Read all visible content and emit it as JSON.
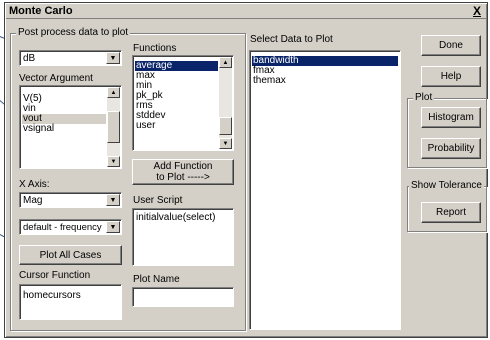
{
  "window": {
    "title": "Monte Carlo",
    "close_label": "X"
  },
  "post_process": {
    "group_label": "Post process data to plot",
    "units_combo": "dB",
    "vector_label": "Vector Argument",
    "vector_items": [
      "V(5)",
      "vin",
      "vout",
      "vsignal"
    ],
    "vector_selected": "vout",
    "xaxis_label": "X Axis:",
    "xaxis_combo": "Mag",
    "freq_combo": "default - frequency",
    "plot_all_button": "Plot All Cases",
    "cursor_label": "Cursor Function",
    "cursor_value": "homecursors"
  },
  "functions": {
    "label": "Functions",
    "items": [
      "average",
      "max",
      "min",
      "pk_pk",
      "rms",
      "stddev",
      "user"
    ],
    "selected": "average",
    "add_button": "Add Function\nto Plot   ----->",
    "script_label": "User Script",
    "script_value": "initialvalue(select)",
    "plot_name_label": "Plot Name",
    "plot_name_value": ""
  },
  "select_data": {
    "label": "Select Data to Plot",
    "items": [
      "bandwidth",
      "fmax",
      "themax"
    ],
    "selected": "bandwidth"
  },
  "buttons": {
    "done": "Done",
    "help": "Help",
    "plot_group": "Plot",
    "histogram": "Histogram",
    "probability": "Probability",
    "tolerance_group": "Show Tolerance",
    "report": "Report"
  },
  "colors": {
    "face": "#d4d0c8",
    "selection": "#0a246a",
    "pointer": "#3a5a7a"
  }
}
